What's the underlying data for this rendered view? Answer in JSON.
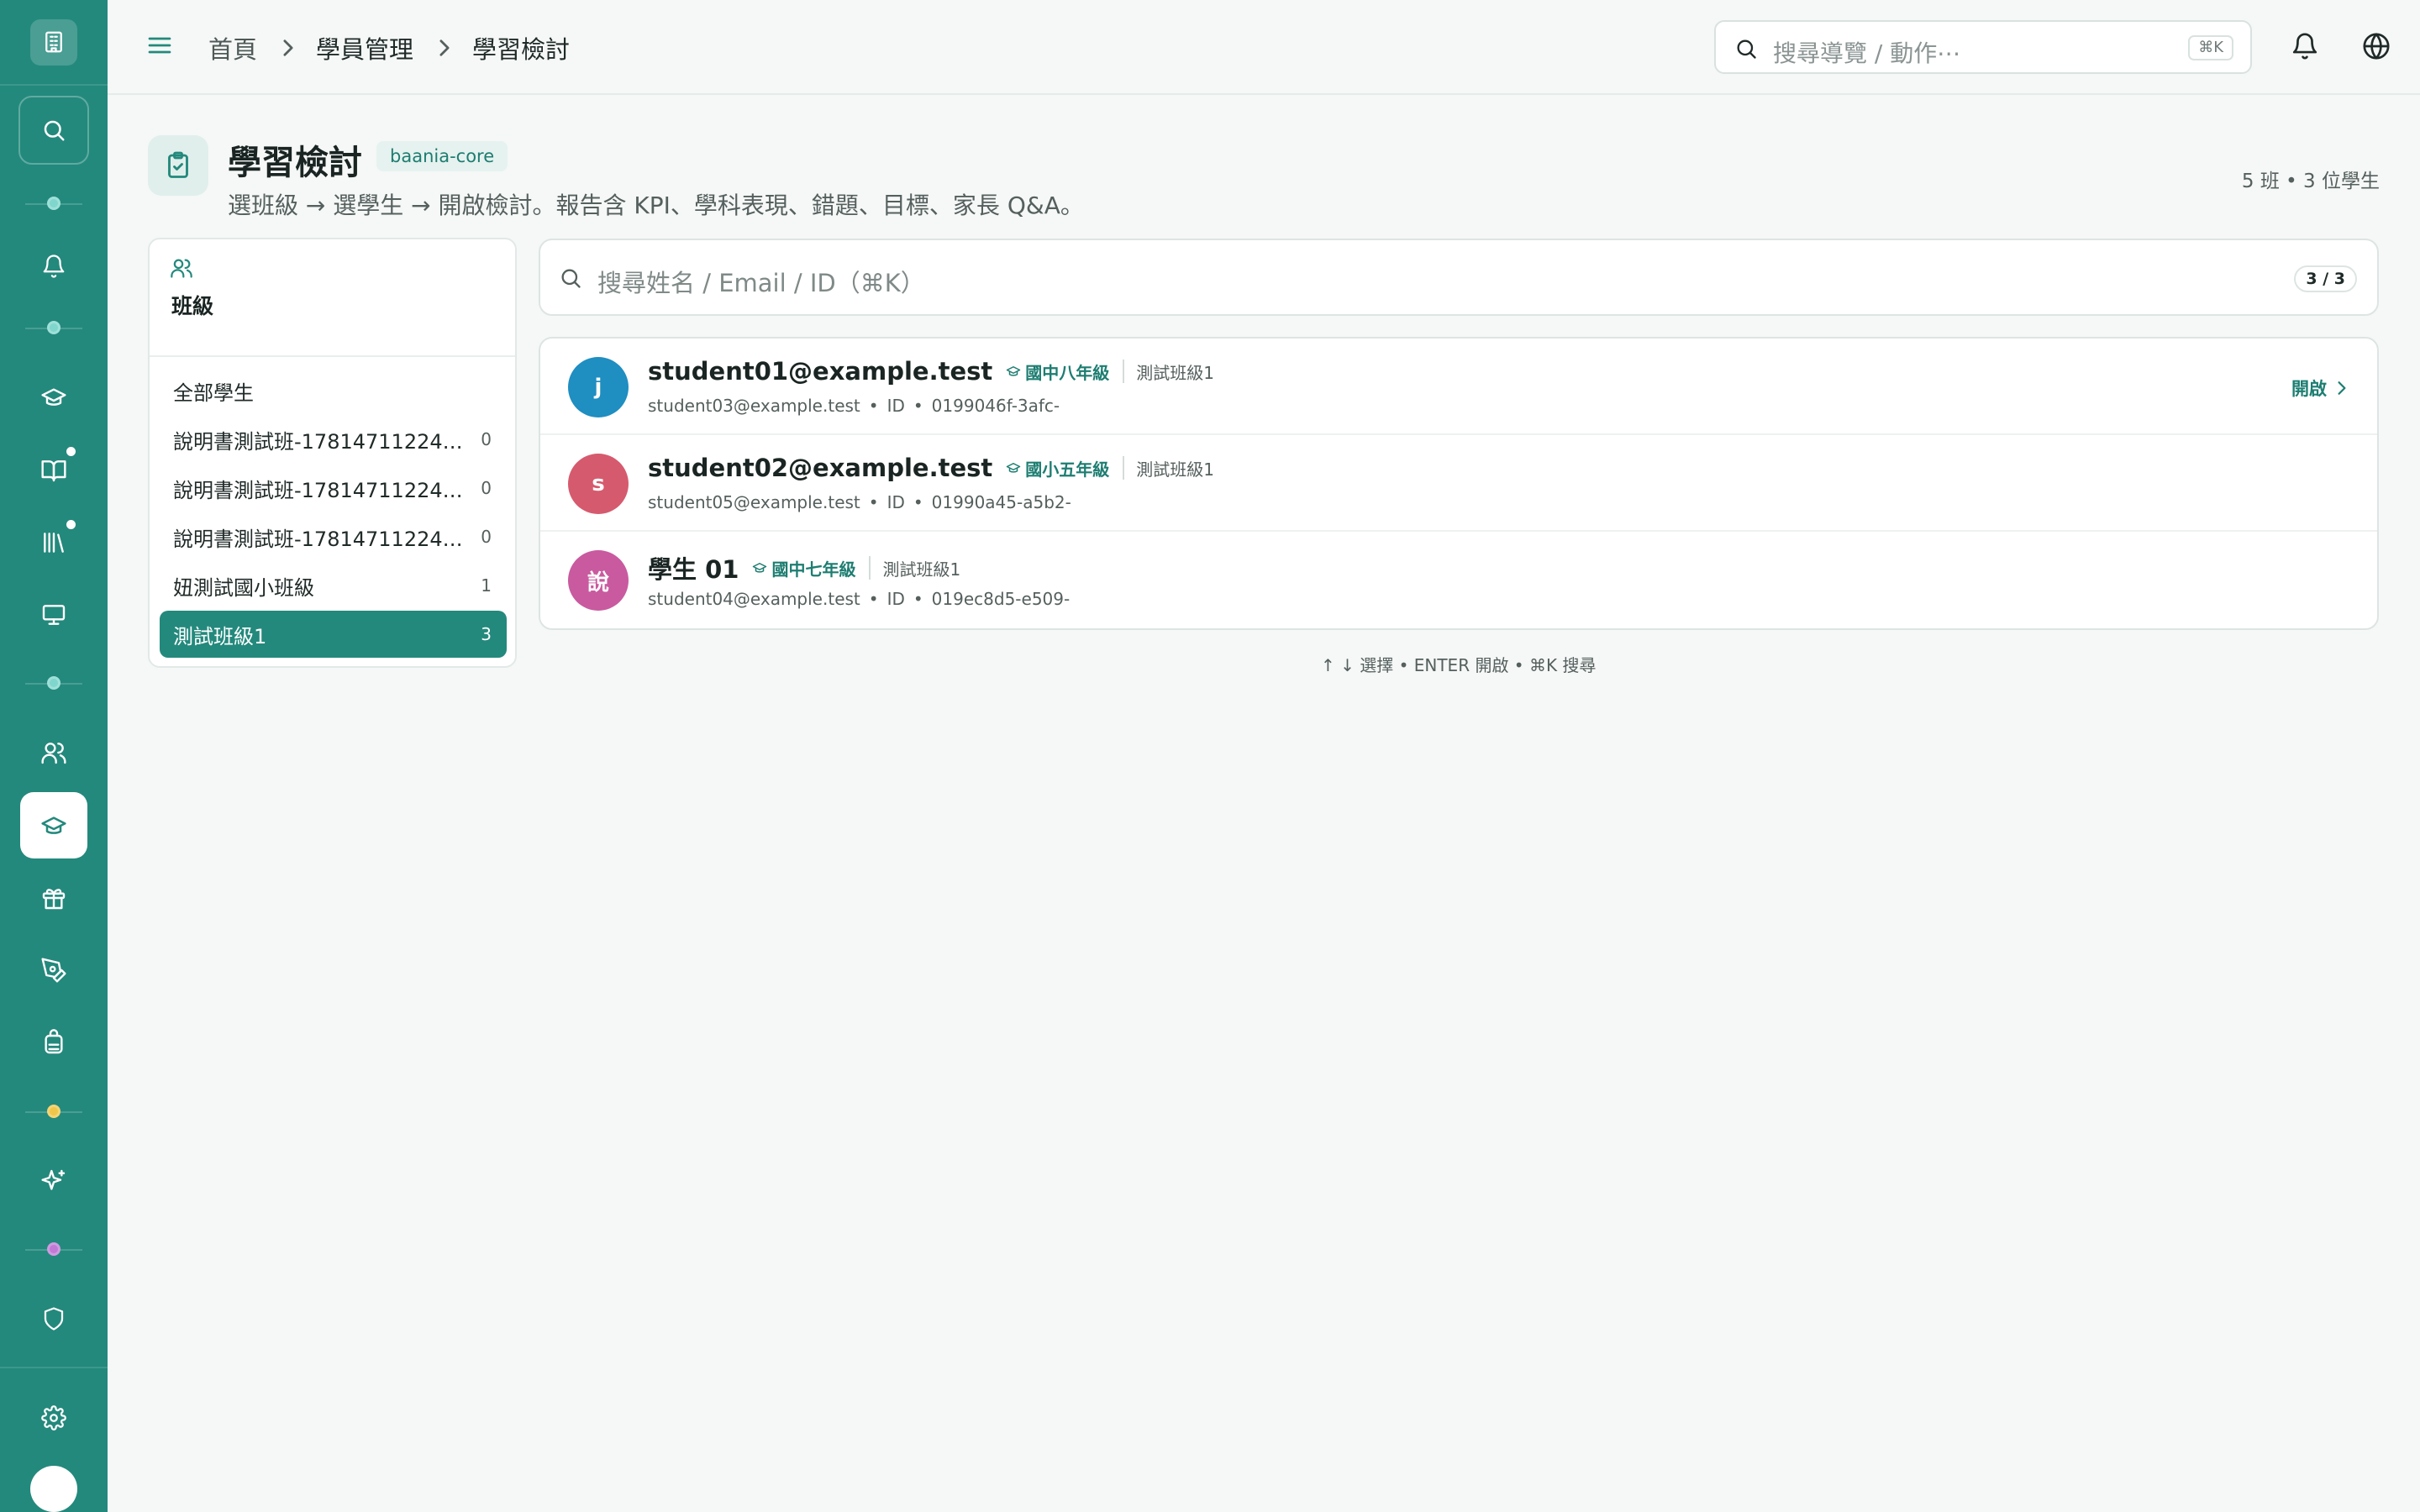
{
  "topbar": {
    "breadcrumb": [
      "首頁",
      "學員管理",
      "學習檢討"
    ],
    "search_placeholder": "搜尋導覽 / 動作⋯",
    "search_shortcut": "⌘K"
  },
  "page": {
    "title": "學習檢討",
    "scope_badge": "baania-core",
    "subtitle": "選班級 → 選學生 → 開啟檢討。報告含 KPI、學科表現、錯題、目標、家長 Q&A。",
    "stats": "5 班 • 3 位學生"
  },
  "classes_panel": {
    "title": "班級",
    "items": [
      {
        "label": "全部學生",
        "count": ""
      },
      {
        "label": "說明書測試班-1781471122472⋯",
        "count": "0"
      },
      {
        "label": "說明書測試班-1781471122472⋯",
        "count": "0"
      },
      {
        "label": "說明書測試班-1781471122472⋯",
        "count": "0"
      },
      {
        "label": "妞測試國小班級",
        "count": "1"
      },
      {
        "label": "測試班級1",
        "count": "3"
      }
    ]
  },
  "student_search": {
    "placeholder": "搜尋姓名 / Email / ID（⌘K）",
    "result_count": "3 / 3"
  },
  "students": [
    {
      "initial": "j",
      "name": "student01@example.test",
      "grade": "國中八年級",
      "class": "測試班級1",
      "email": "student03@example.test",
      "id_label": "ID",
      "id": "0199046f-3afc-",
      "action": "開啟"
    },
    {
      "initial": "s",
      "name": "student02@example.test",
      "grade": "國小五年級",
      "class": "測試班級1",
      "email": "student05@example.test",
      "id_label": "ID",
      "id": "01990a45-a5b2-",
      "action": ""
    },
    {
      "initial": "說",
      "name": "學生 01",
      "grade": "國中七年級",
      "class": "測試班級1",
      "email": "student04@example.test",
      "id_label": "ID",
      "id": "019ec8d5-e509-",
      "action": ""
    }
  ],
  "keyboard_hint": "↑ ↓ 選擇 • ENTER 開啟 • ⌘K 搜尋",
  "colors": {
    "brand": "#23897c",
    "avatar_1": "#1f8ec1",
    "avatar_2": "#d65a6e",
    "avatar_3": "#c95a9f",
    "accent_text": "#1d7d71"
  },
  "sidebar_icons": [
    "building-icon",
    "search-icon",
    "bell-icon",
    "graduation-cap-icon",
    "book-open-icon",
    "library-icon",
    "monitor-icon",
    "users-icon",
    "graduation-cap-icon",
    "gift-icon",
    "pen-tool-icon",
    "backpack-icon",
    "sparkles-icon",
    "shield-icon",
    "gear-icon"
  ]
}
